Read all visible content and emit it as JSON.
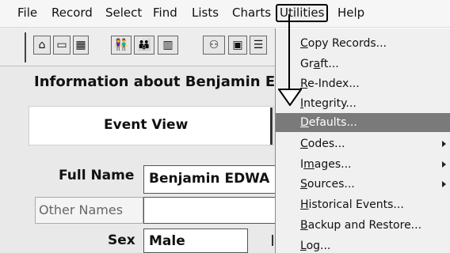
{
  "menubar": {
    "items": [
      "File",
      "Record",
      "Select",
      "Find",
      "Lists",
      "Charts",
      "Utilities",
      "Help"
    ],
    "active": "Utilities"
  },
  "toolbar": {
    "icons": [
      "home-icon",
      "card-icon",
      "calculator-icon",
      "couple-icon",
      "family-icon",
      "book-icon",
      "group-icon",
      "album-icon",
      "register-icon"
    ]
  },
  "main": {
    "info_title": "Information about Benjamin E",
    "event_view_label": "Event View",
    "full_name_label": "Full Name",
    "full_name_value": "Benjamin EDWA",
    "other_names_label": "Other Names",
    "sex_label": "Sex",
    "sex_value": "Male"
  },
  "utilities_menu": {
    "items": [
      {
        "pre": "",
        "u": "C",
        "post": "opy Records...",
        "submenu": false
      },
      {
        "pre": "Gr",
        "u": "a",
        "post": "ft...",
        "submenu": false
      },
      {
        "pre": "",
        "u": "R",
        "post": "e-Index...",
        "submenu": false
      },
      {
        "pre": "",
        "u": "I",
        "post": "ntegrity...",
        "submenu": false
      },
      {
        "pre": "",
        "u": "D",
        "post": "efaults...",
        "submenu": false,
        "selected": true
      },
      {
        "pre": "",
        "u": "C",
        "post": "odes...",
        "submenu": true
      },
      {
        "pre": "I",
        "u": "m",
        "post": "ages...",
        "submenu": true
      },
      {
        "pre": "",
        "u": "S",
        "post": "ources...",
        "submenu": true
      },
      {
        "pre": "",
        "u": "H",
        "post": "istorical Events...",
        "submenu": false
      },
      {
        "pre": "",
        "u": "B",
        "post": "ackup and Restore...",
        "submenu": false
      },
      {
        "pre": "",
        "u": "L",
        "post": "og...",
        "submenu": false
      }
    ]
  }
}
